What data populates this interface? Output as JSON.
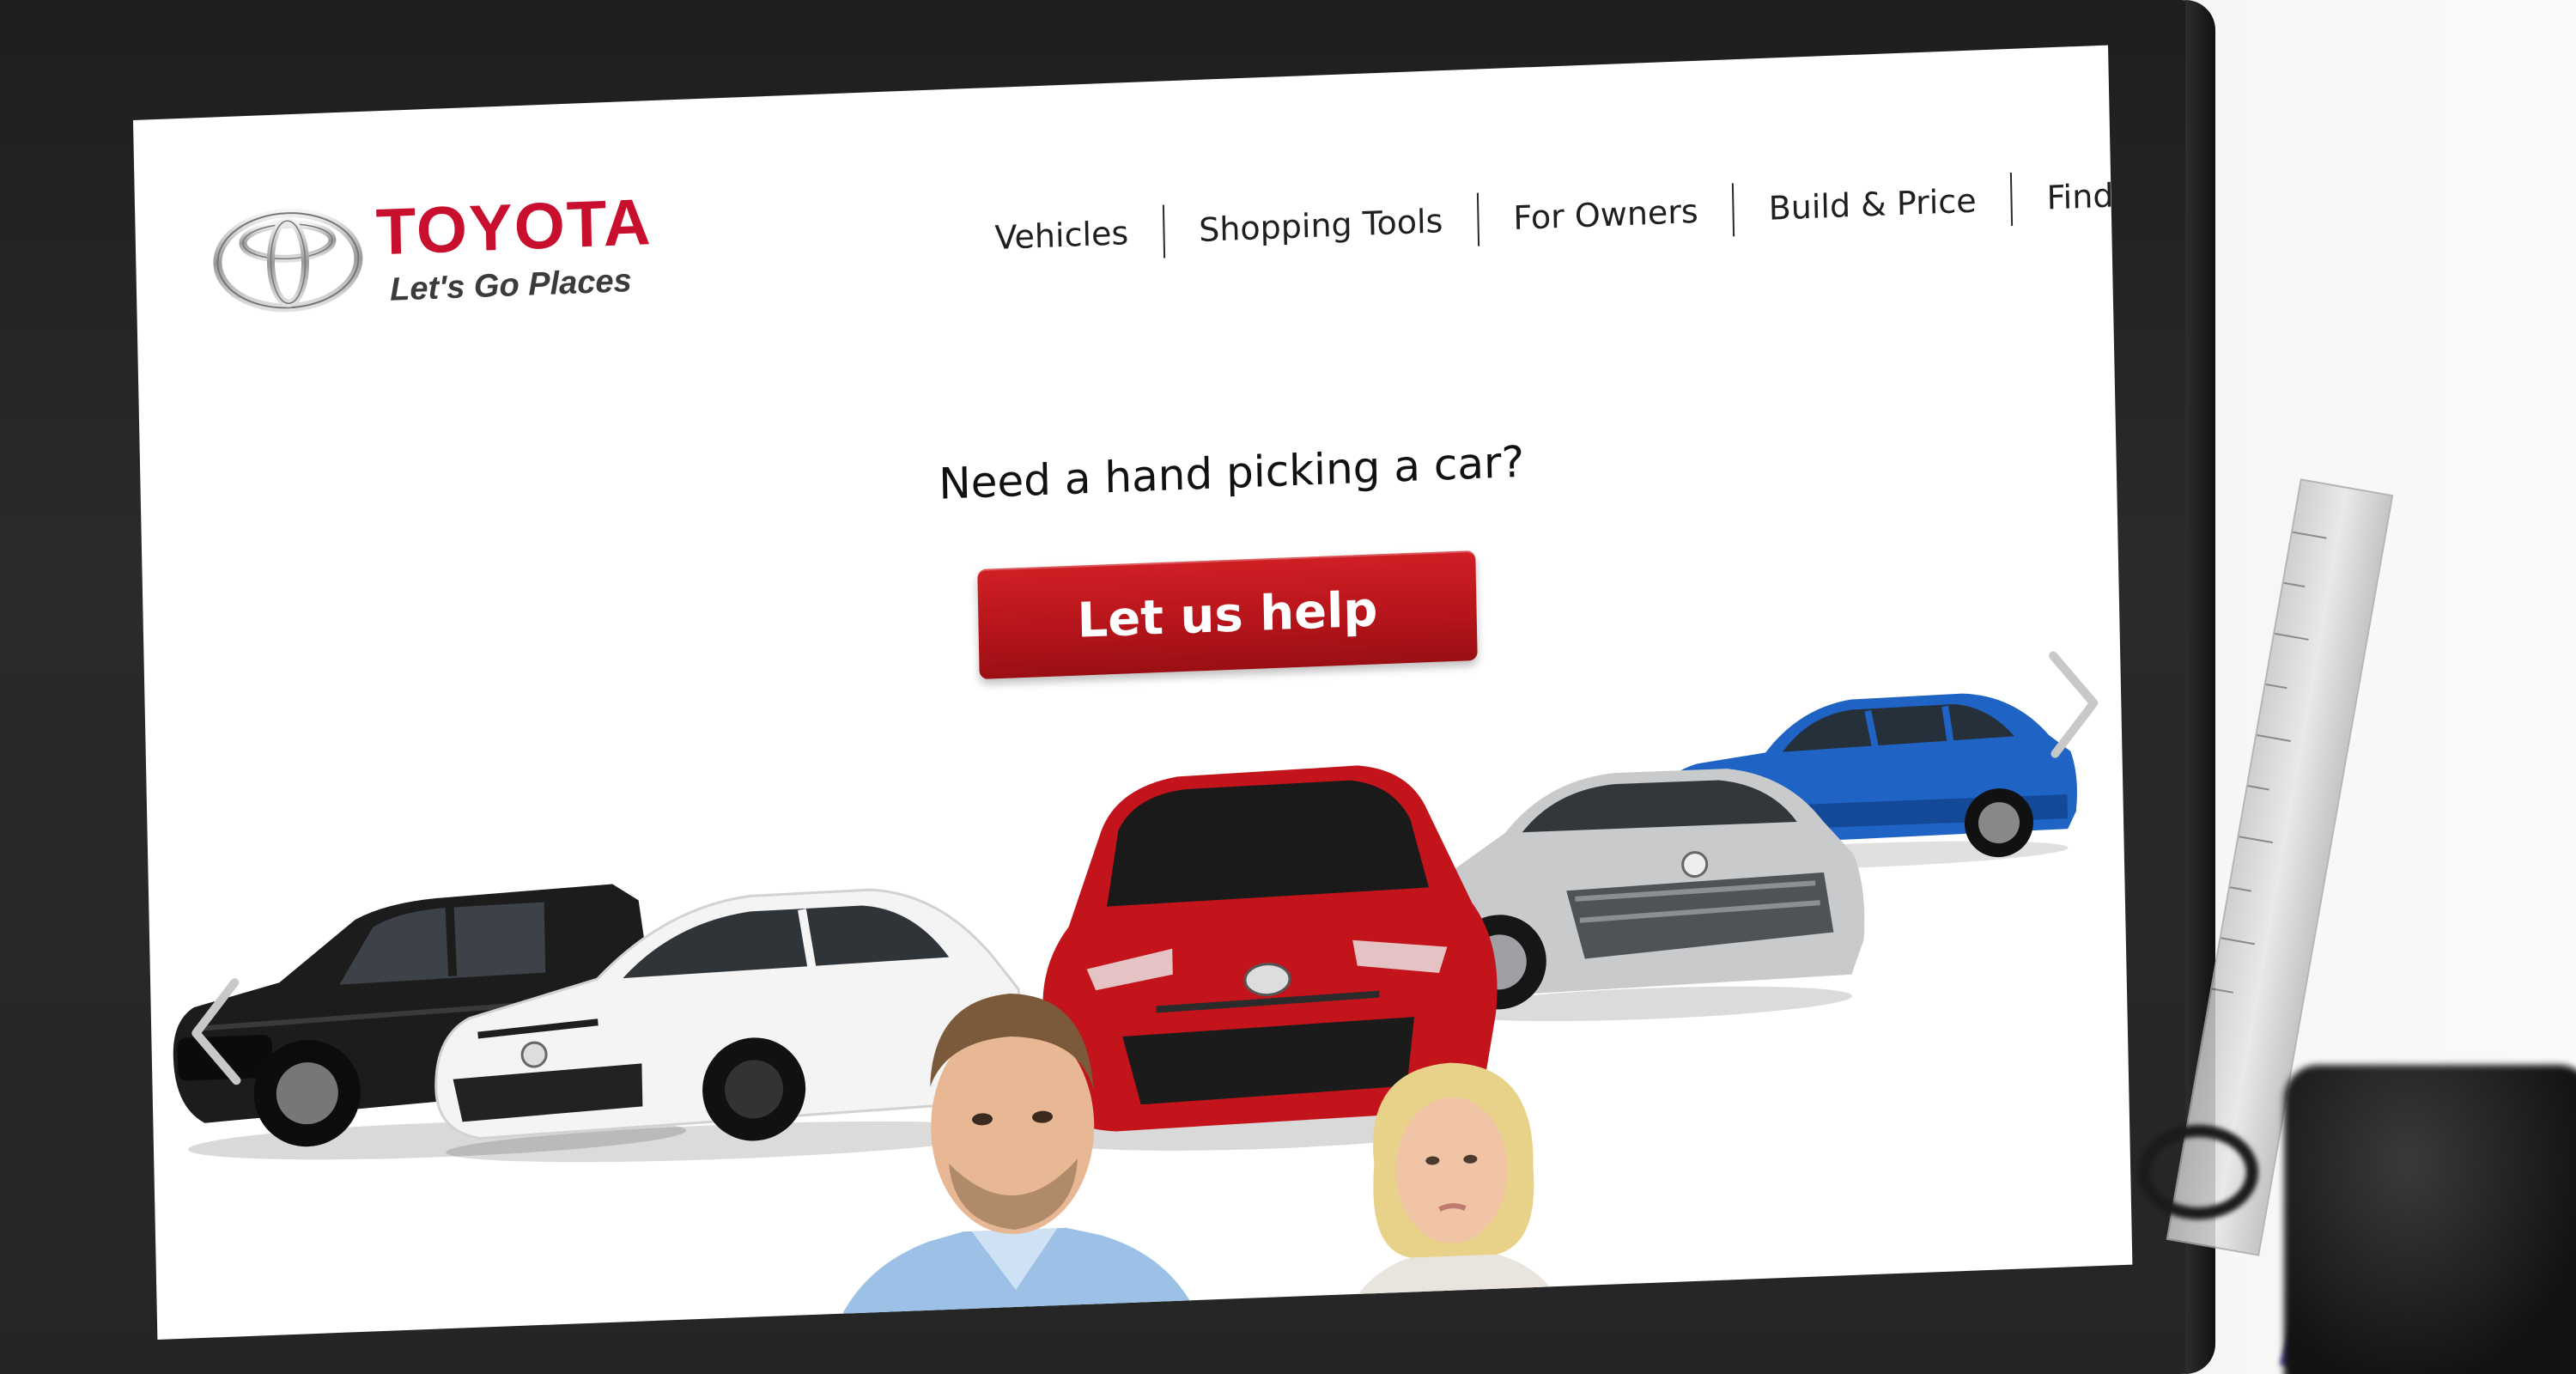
{
  "brand": {
    "name": "TOYOTA",
    "tagline": "Let's Go Places",
    "color": "#c8102e"
  },
  "nav": {
    "items": [
      {
        "label": "Vehicles"
      },
      {
        "label": "Shopping Tools"
      },
      {
        "label": "For Owners"
      },
      {
        "label": "Build & Price"
      },
      {
        "label": "Find a Dealer"
      }
    ]
  },
  "hero": {
    "question": "Need a hand picking a car?",
    "cta_label": "Let us help",
    "cta_color": "#b3141a"
  },
  "carousel": {
    "prev_icon": "chevron-left-icon",
    "next_icon": "chevron-right-icon",
    "cars": [
      {
        "model": "pickup-truck",
        "color": "#1c1c1c"
      },
      {
        "model": "white-sedan",
        "color": "#f4f4f4"
      },
      {
        "model": "red-sedan",
        "color": "#c4141b"
      },
      {
        "model": "silver-sedan",
        "color": "#c9cacc"
      },
      {
        "model": "blue-suv",
        "color": "#1f63c4"
      }
    ]
  }
}
